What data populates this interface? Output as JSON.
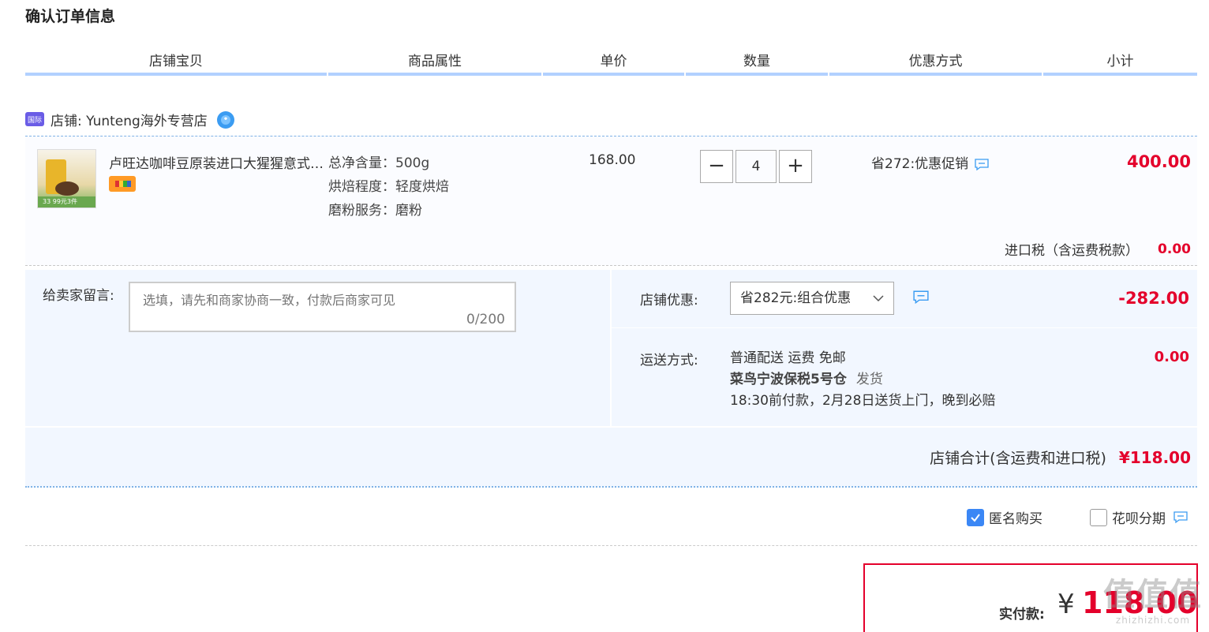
{
  "page": {
    "title": "确认订单信息"
  },
  "columns": [
    "店铺宝贝",
    "商品属性",
    "单价",
    "数量",
    "优惠方式",
    "小计"
  ],
  "shop": {
    "badge": "国际",
    "label": "店铺: Yunteng海外专营店"
  },
  "item": {
    "thumb_caption": "33  99元3件",
    "title": "卢旺达咖啡豆原装进口大猩猩意式拼配咖啡豆",
    "attrs": [
      "总净含量：500g",
      "烘焙程度：轻度烘焙",
      "磨粉服务：磨粉"
    ],
    "price": "168.00",
    "quantity": "4",
    "minus": "−",
    "plus": "+",
    "promo": "省272:优惠促销",
    "subtotal": "400.00",
    "tax_label": "进口税（含运费税款）",
    "tax_value": "0.00"
  },
  "remark": {
    "label": "给卖家留言:",
    "placeholder": "选填，请先和商家协商一致，付款后商家可见",
    "count": "0/200"
  },
  "coupon": {
    "label": "店铺优惠:",
    "selected": "省282元:组合优惠",
    "value": "-282.00"
  },
  "shipping": {
    "label": "运送方式:",
    "method": "普通配送 运费 免邮",
    "warehouse": "菜鸟宁波保税5号仓",
    "dispatch": "发货",
    "eta": "18:30前付款，2月28日送货上门，晚到必赔",
    "value": "0.00"
  },
  "total": {
    "label": "店铺合计(含运费和进口税)",
    "amount": "¥118.00"
  },
  "options": {
    "anonymous": "匿名购买",
    "huabei": "花呗分期"
  },
  "pay": {
    "label": "实付款:",
    "currency": "¥",
    "amount": "118.00"
  },
  "watermark": {
    "line1": "值值值",
    "line2": "zhizhizhi.com"
  },
  "colors": {
    "accent": "#e4002b",
    "header_line": "#b2d1ff",
    "panel": "#f2f7ff",
    "checkbox": "#3b87f5"
  }
}
